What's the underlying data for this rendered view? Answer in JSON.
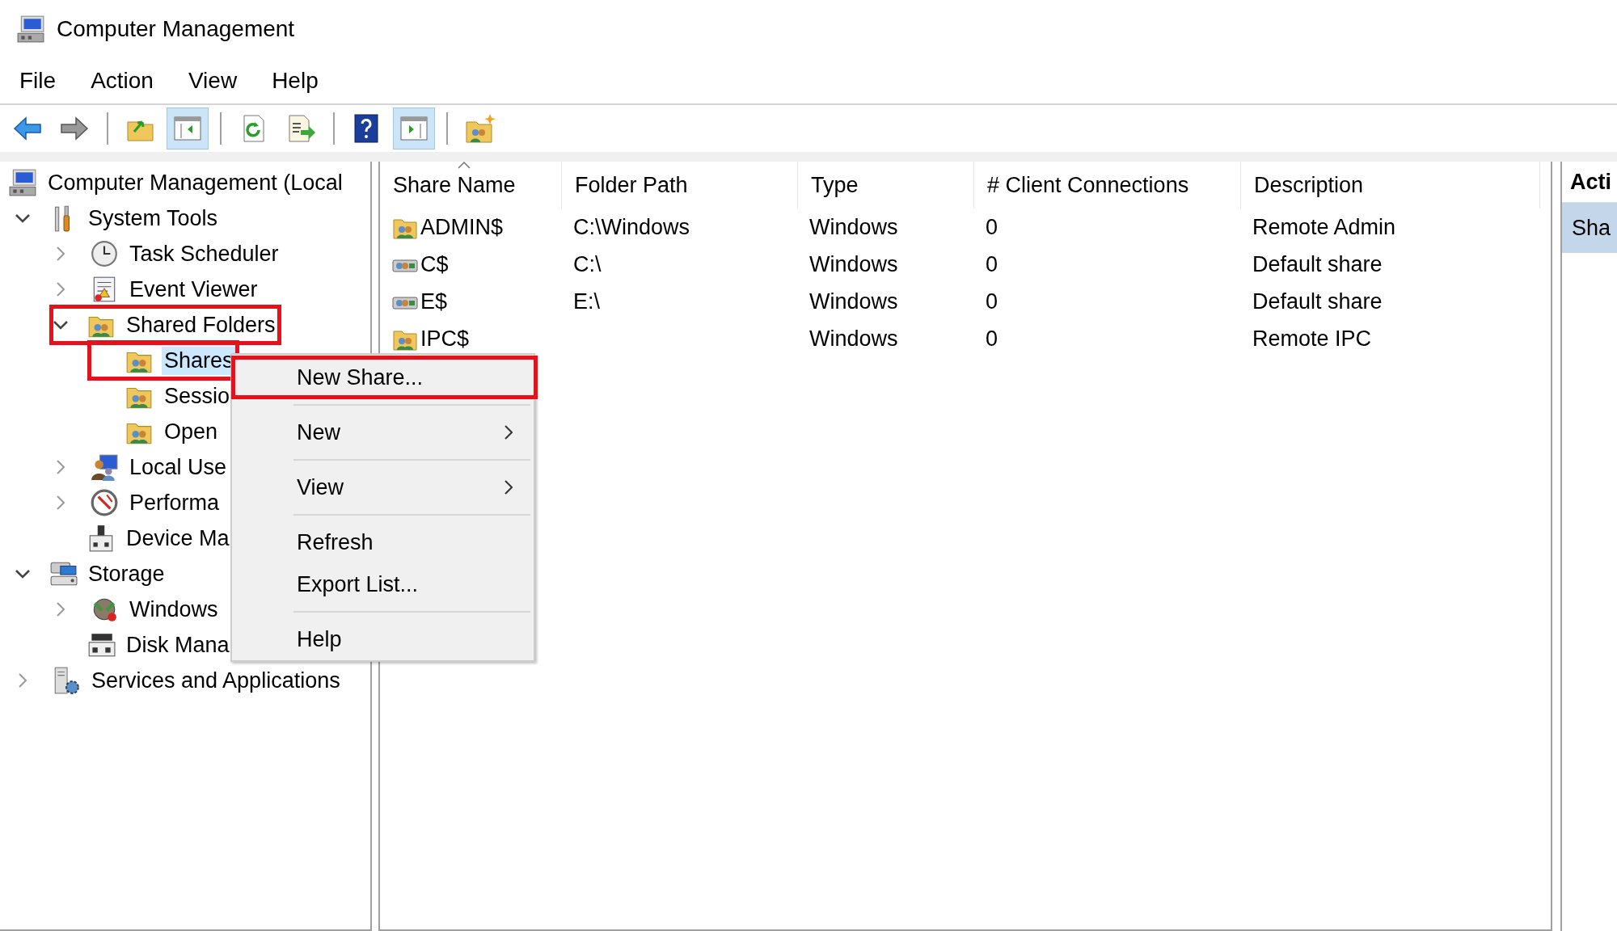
{
  "window": {
    "title": "Computer Management"
  },
  "menu_bar": [
    "File",
    "Action",
    "View",
    "Help"
  ],
  "toolbar": [
    {
      "kind": "button",
      "pressed": false
    },
    {
      "kind": "button",
      "pressed": false
    },
    {
      "kind": "separator"
    },
    {
      "kind": "button",
      "pressed": false
    },
    {
      "kind": "button",
      "pressed": true
    },
    {
      "kind": "separator"
    },
    {
      "kind": "button",
      "pressed": false
    },
    {
      "kind": "button",
      "pressed": false
    },
    {
      "kind": "separator"
    },
    {
      "kind": "button",
      "pressed": false
    },
    {
      "kind": "button",
      "pressed": true
    },
    {
      "kind": "separator"
    },
    {
      "kind": "button",
      "pressed": false
    }
  ],
  "tree": [
    {
      "label": "Computer Management (Local",
      "selected": false,
      "annotated": false,
      "children": [
        {
          "label": "System Tools",
          "expanded": true,
          "selected": false,
          "annotated": false,
          "children": [
            {
              "label": "Task Scheduler",
              "expanded": false,
              "selected": false,
              "annotated": false
            },
            {
              "label": "Event Viewer",
              "expanded": false,
              "selected": false,
              "annotated": false
            },
            {
              "label": "Shared Folders",
              "expanded": true,
              "selected": false,
              "annotated": true,
              "children": [
                {
                  "label": "Shares",
                  "selected": true,
                  "annotated": true
                },
                {
                  "label": "Sessio",
                  "selected": false,
                  "annotated": false
                },
                {
                  "label": "Open",
                  "selected": false,
                  "annotated": false
                }
              ]
            },
            {
              "label": "Local Use",
              "expanded": false,
              "selected": false,
              "annotated": false
            },
            {
              "label": "Performa",
              "expanded": false,
              "selected": false,
              "annotated": false
            },
            {
              "label": "Device Ma",
              "selected": false,
              "annotated": false
            }
          ]
        },
        {
          "label": "Storage",
          "expanded": true,
          "selected": false,
          "annotated": false,
          "children": [
            {
              "label": "Windows",
              "expanded": false,
              "selected": false,
              "annotated": false
            },
            {
              "label": "Disk Mana",
              "selected": false,
              "annotated": false
            }
          ]
        },
        {
          "label": "Services and Applications",
          "expanded": false,
          "selected": false,
          "annotated": false
        }
      ]
    }
  ],
  "table": {
    "columns": [
      {
        "label": "Share Name",
        "sorted": true
      },
      {
        "label": "Folder Path",
        "sorted": false
      },
      {
        "label": "Type",
        "sorted": false
      },
      {
        "label": "# Client Connections",
        "sorted": false
      },
      {
        "label": "Description",
        "sorted": false
      }
    ],
    "rows": [
      [
        "ADMIN$",
        "C:\\Windows",
        "Windows",
        "0",
        "Remote Admin"
      ],
      [
        "C$",
        "C:\\",
        "Windows",
        "0",
        "Default share"
      ],
      [
        "E$",
        "E:\\",
        "Windows",
        "0",
        "Default share"
      ],
      [
        "IPC$",
        "",
        "Windows",
        "0",
        "Remote IPC"
      ]
    ]
  },
  "actions_pane": {
    "title": "Acti",
    "items": [
      "Sha"
    ]
  },
  "context_menu": [
    {
      "kind": "item",
      "label": "New Share...",
      "submenu": false,
      "annotated": true
    },
    {
      "kind": "separator"
    },
    {
      "kind": "item",
      "label": "New",
      "submenu": true,
      "annotated": false
    },
    {
      "kind": "separator"
    },
    {
      "kind": "item",
      "label": "View",
      "submenu": true,
      "annotated": false
    },
    {
      "kind": "separator"
    },
    {
      "kind": "item",
      "label": "Refresh",
      "submenu": false,
      "annotated": false
    },
    {
      "kind": "item",
      "label": "Export List...",
      "submenu": false,
      "annotated": false
    },
    {
      "kind": "separator"
    },
    {
      "kind": "item",
      "label": "Help",
      "submenu": false,
      "annotated": false
    }
  ]
}
